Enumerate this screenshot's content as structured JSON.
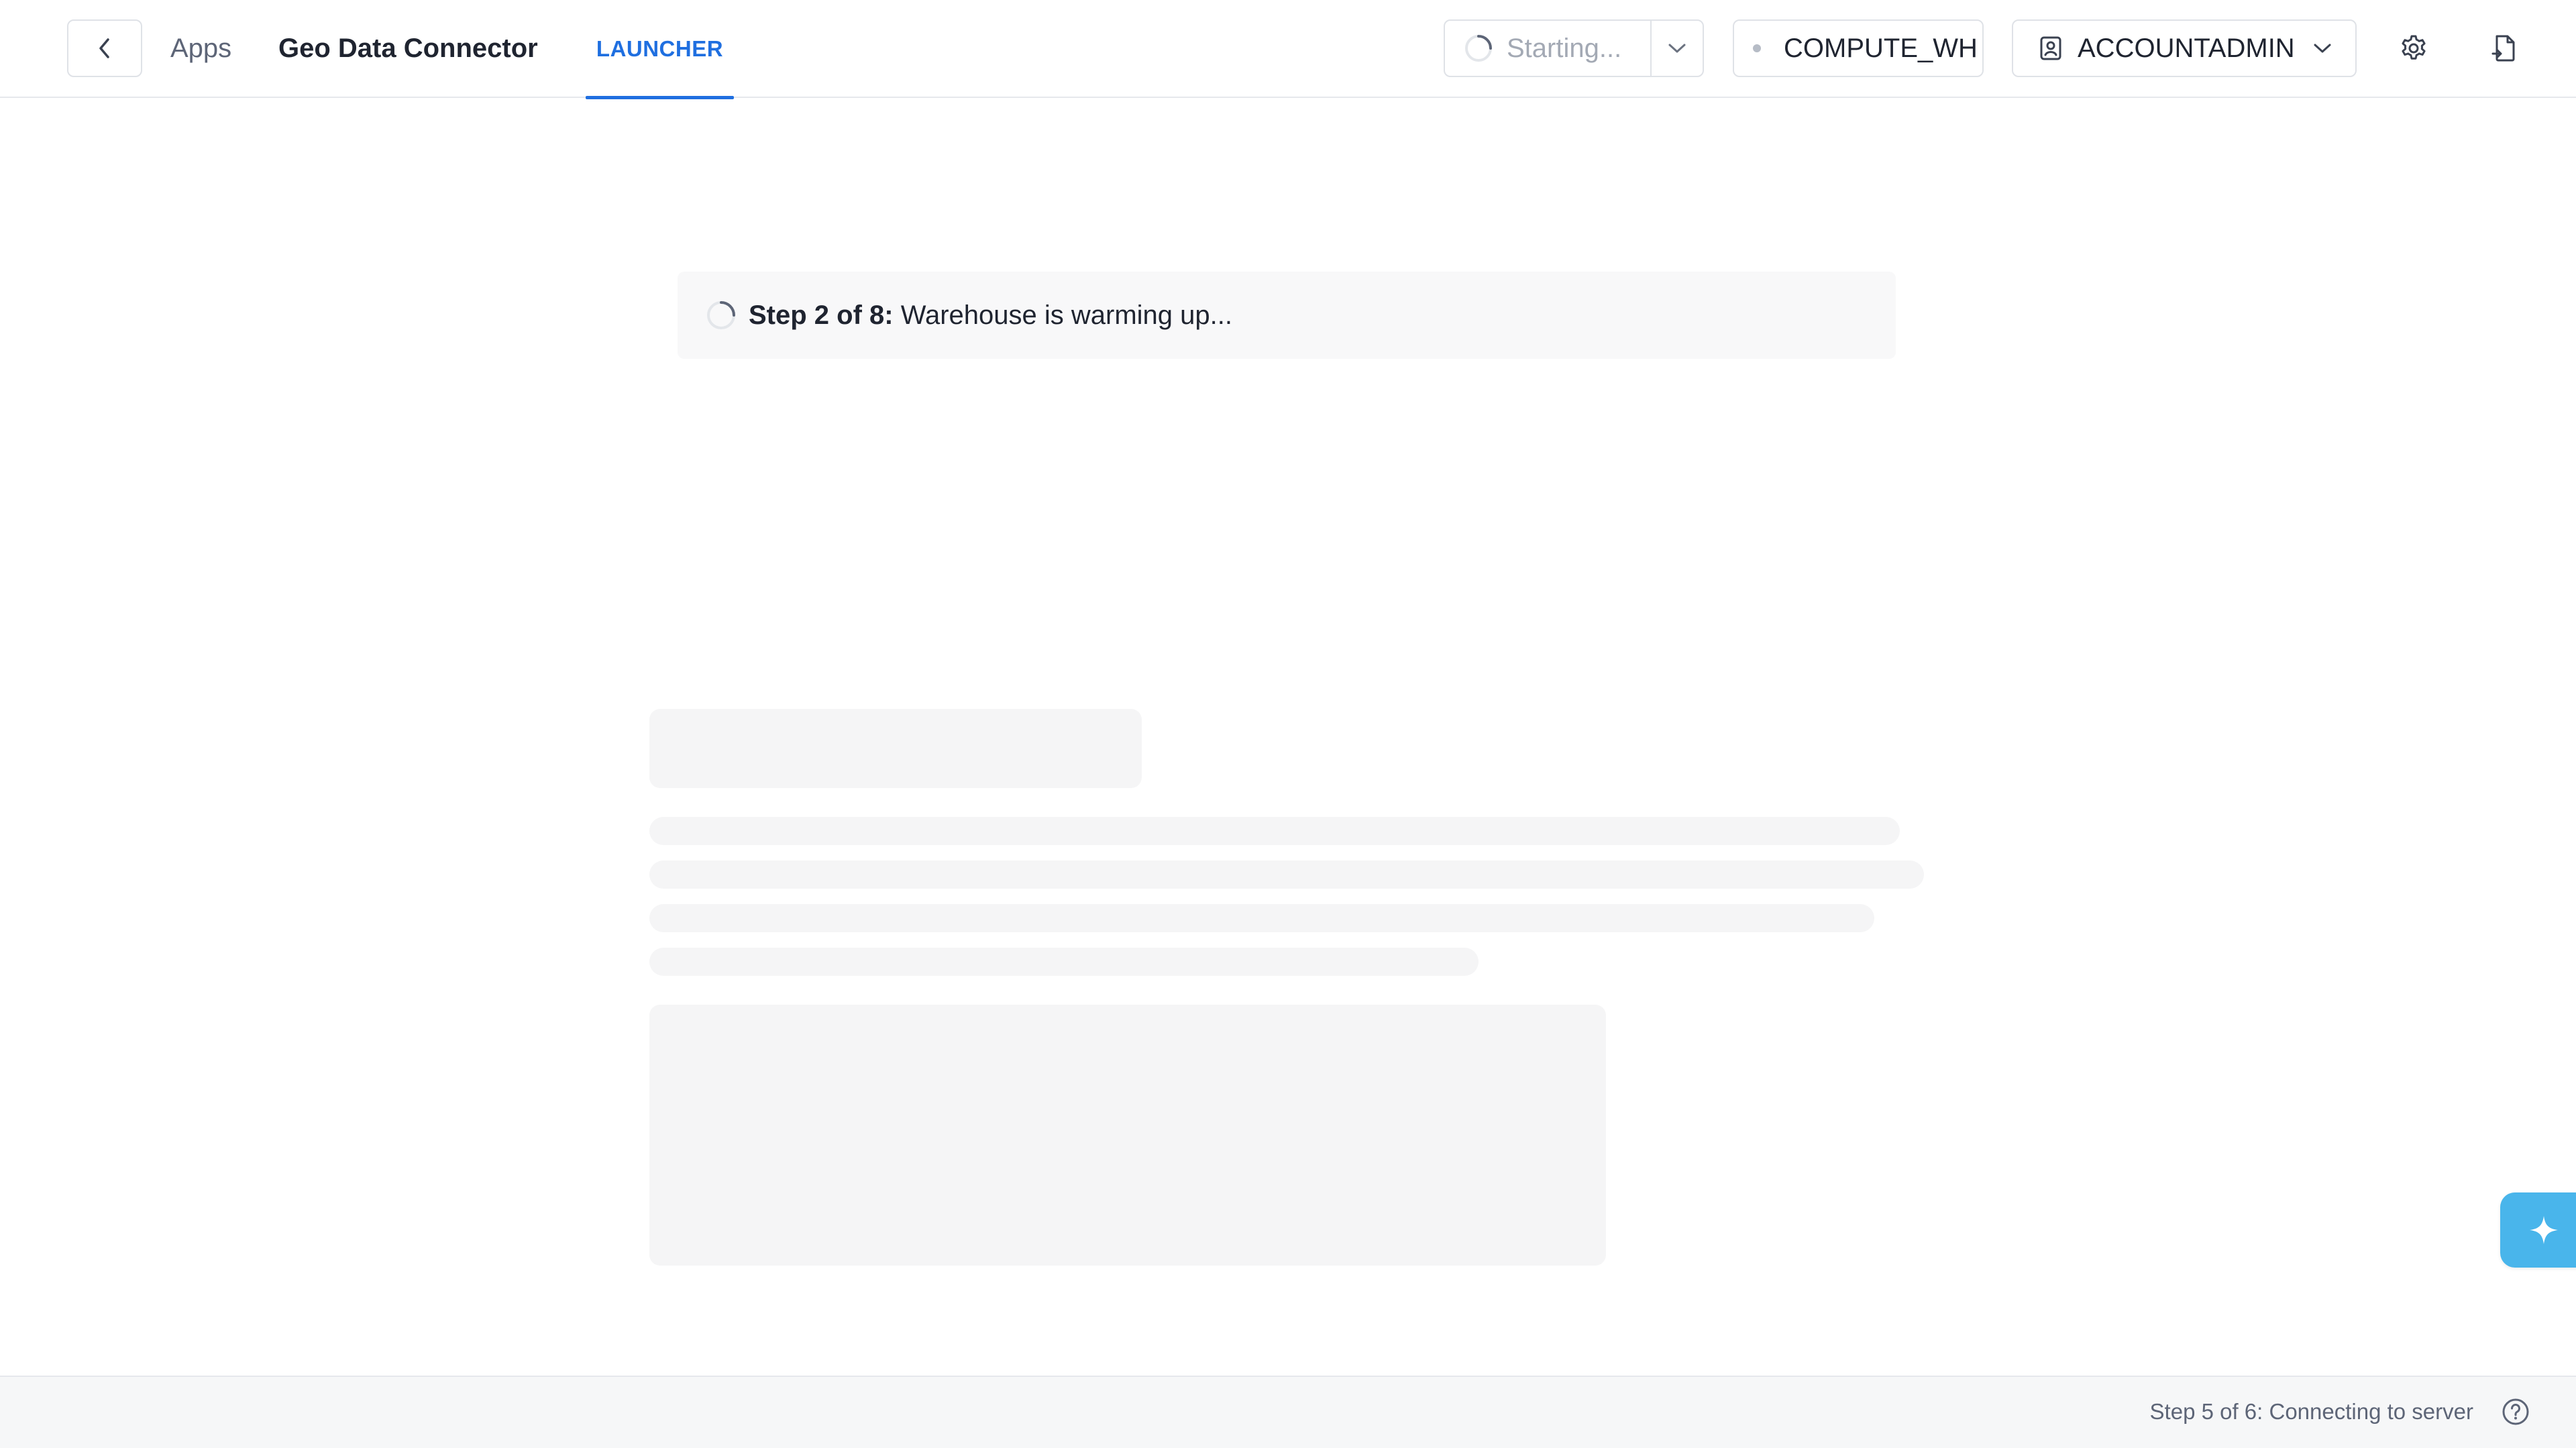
{
  "header": {
    "breadcrumb_root": "Apps",
    "app_name": "Geo Data Connector",
    "tabs": [
      {
        "label": "LAUNCHER",
        "active": true
      }
    ],
    "run_status": "Starting...",
    "warehouse": "COMPUTE_WH",
    "role": "ACCOUNTADMIN",
    "icons": {
      "back": "chevron-left-icon",
      "run_spinner": "spinner-icon",
      "run_menu": "chevron-down-icon",
      "warehouse_status": "status-dot-icon",
      "role": "user-badge-icon",
      "role_menu": "chevron-down-icon",
      "settings": "gear-icon",
      "share": "document-share-icon"
    }
  },
  "main": {
    "step_banner": {
      "step": "Step 2 of 8:",
      "message": " Warehouse is warming up..."
    },
    "assistant_icon": "sparkle-icon"
  },
  "footer": {
    "status": "Step 5 of 6: Connecting to server",
    "help_icon": "help-circle-icon"
  },
  "colors": {
    "accent": "#1f6fe0",
    "assistant": "#49b5eb",
    "skeleton": "#f5f5f6",
    "banner_bg": "#f8f8f9",
    "footer_bg": "#f6f7f8",
    "border": "#dfe2e7"
  }
}
